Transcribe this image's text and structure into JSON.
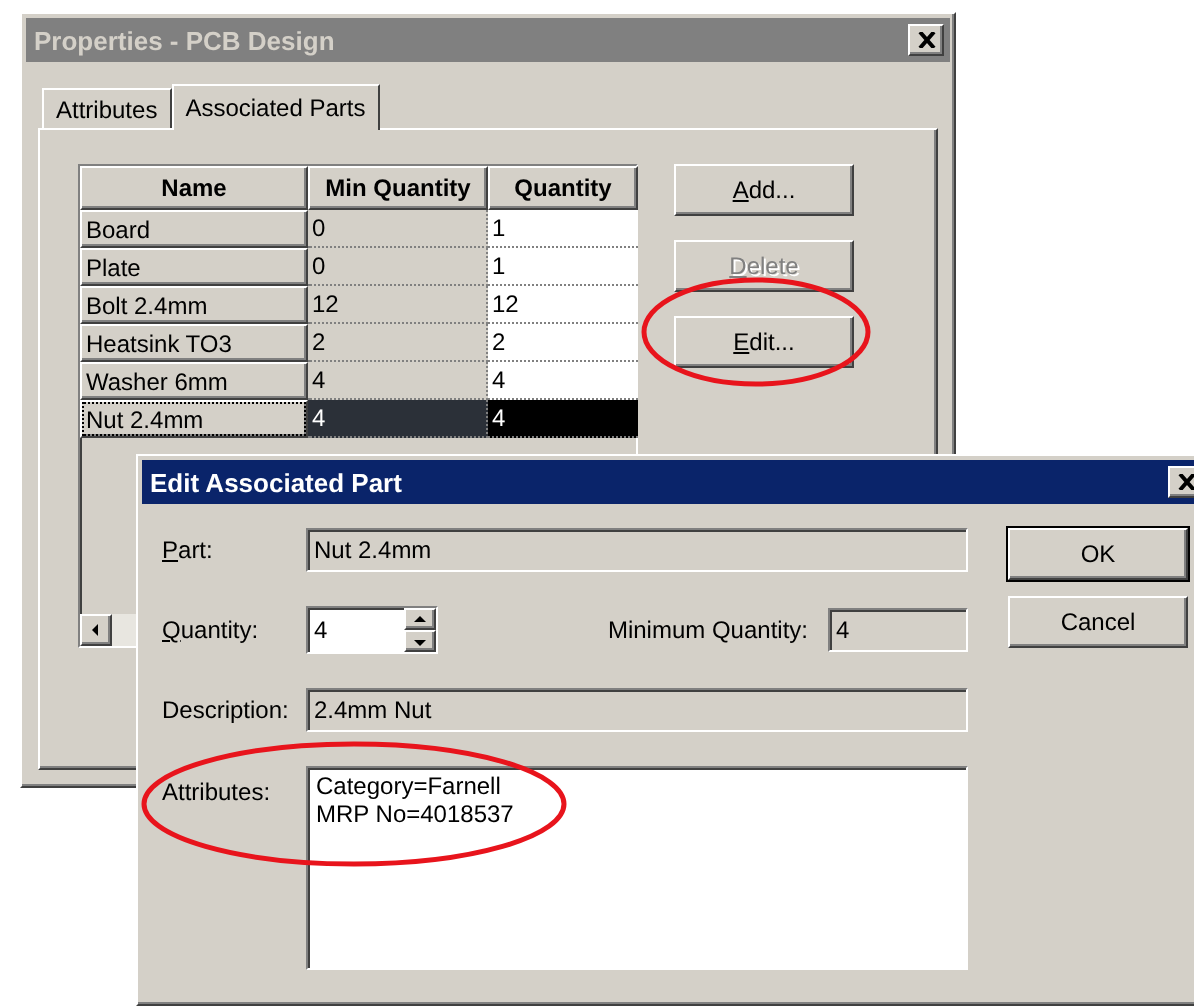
{
  "properties_window": {
    "title": "Properties - PCB Design",
    "active": false,
    "tabs": [
      {
        "label": "Attributes",
        "selected": false
      },
      {
        "label": "Associated Parts",
        "selected": true
      }
    ],
    "table": {
      "columns": [
        "Name",
        "Min Quantity",
        "Quantity"
      ],
      "rows": [
        {
          "name": "Board",
          "min_quantity": "0",
          "quantity": "1",
          "selected": false
        },
        {
          "name": "Plate",
          "min_quantity": "0",
          "quantity": "1",
          "selected": false
        },
        {
          "name": "Bolt 2.4mm",
          "min_quantity": "12",
          "quantity": "12",
          "selected": false
        },
        {
          "name": "Heatsink TO3",
          "min_quantity": "2",
          "quantity": "2",
          "selected": false
        },
        {
          "name": "Washer 6mm",
          "min_quantity": "4",
          "quantity": "4",
          "selected": false
        },
        {
          "name": "Nut 2.4mm",
          "min_quantity": "4",
          "quantity": "4",
          "selected": true
        }
      ]
    },
    "buttons": [
      {
        "label": "Add...",
        "mnemonic": true,
        "disabled": false
      },
      {
        "label": "Delete",
        "mnemonic": true,
        "disabled": true
      },
      {
        "label": "Edit...",
        "mnemonic": true,
        "disabled": false
      }
    ]
  },
  "edit_dialog": {
    "title": "Edit Associated Part",
    "active": true,
    "part": {
      "label": "Part:",
      "mnemonic": true,
      "value": "Nut 2.4mm"
    },
    "quantity": {
      "label": "Quantity:",
      "mnemonic": true,
      "value": "4"
    },
    "minimum_quantity": {
      "label": "Minimum Quantity:",
      "value": "4"
    },
    "description": {
      "label": "Description:",
      "value": "2.4mm Nut"
    },
    "attributes": {
      "label": "Attributes:",
      "lines": [
        "Category=Farnell",
        "MRP No=4018537"
      ]
    },
    "buttons": [
      {
        "label": "OK",
        "default": true
      },
      {
        "label": "Cancel",
        "default": false
      }
    ]
  }
}
